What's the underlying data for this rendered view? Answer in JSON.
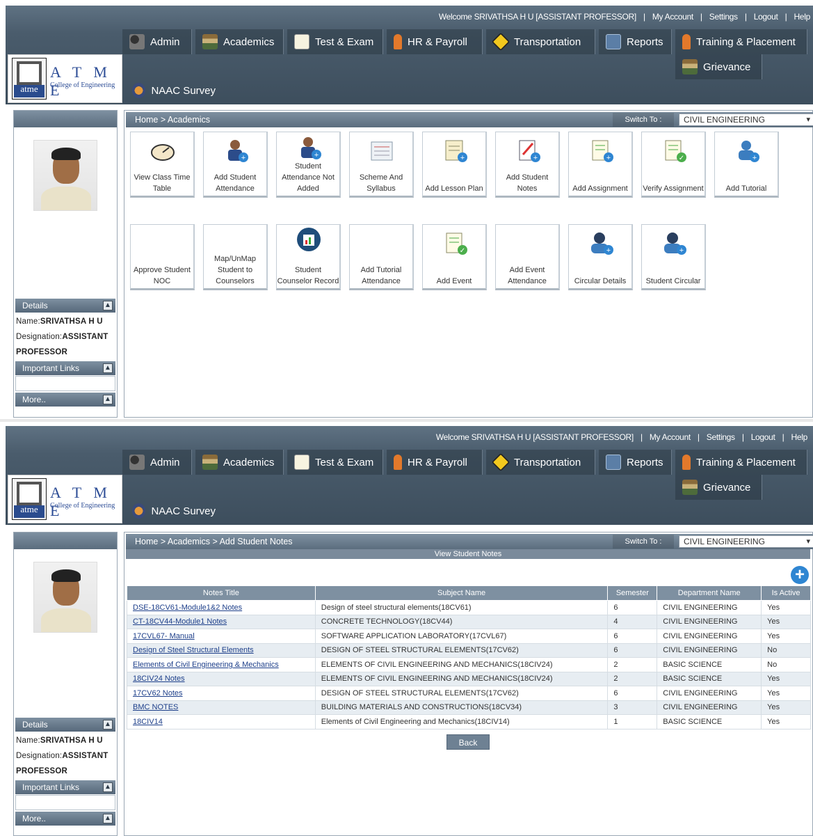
{
  "header": {
    "welcome": "Welcome SRIVATHSA H U [ASSISTANT PROFESSOR]",
    "links": [
      "My Account",
      "Settings",
      "Logout",
      "Help"
    ],
    "logo_text": "A T M E",
    "logo_tag": "atme",
    "logo_subtitle": "College of Engineering",
    "menu": [
      "Admin",
      "Academics",
      "Test & Exam",
      "HR & Payroll",
      "Transportation",
      "Reports",
      "Training & Placement",
      "Grievance",
      "NAAC Survey"
    ]
  },
  "sidebar": {
    "details_label": "Details",
    "name_label": "Name:",
    "name_value": "SRIVATHSA H U",
    "designation_label": "Designation:",
    "designation_value": "ASSISTANT",
    "designation_value2": "PROFESSOR",
    "important_links_label": "Important Links",
    "more_label": "More..",
    "toggle_glyph": "▲"
  },
  "switch": {
    "label": "Switch To :",
    "value": "CIVIL ENGINEERING"
  },
  "pane1": {
    "breadcrumb": "Home > Academics",
    "tiles_row1": [
      "View Class Time Table",
      "Add Student Attendance",
      "Student Attendance Not Added",
      "Scheme And Syllabus",
      "Add Lesson Plan",
      "Add Student Notes",
      "Add Assignment",
      "Verify Assignment",
      "Add Tutorial"
    ],
    "tiles_row2": [
      "Approve Student NOC",
      "Map/UnMap Student to Counselors",
      "Student Counselor Record",
      "Add Tutorial Attendance",
      "Add Event",
      "Add Event Attendance",
      "Circular Details",
      "Student Circular"
    ]
  },
  "pane2": {
    "breadcrumb": "Home > Academics > Add Student Notes",
    "section_title": "View Student Notes",
    "add_glyph": "+",
    "columns": [
      "Notes Title",
      "Subject Name",
      "Semester",
      "Department Name",
      "Is Active"
    ],
    "rows": [
      [
        "DSE-18CV61-Module1&2 Notes",
        "Design of steel structural elements(18CV61)",
        "6",
        "CIVIL ENGINEERING",
        "Yes"
      ],
      [
        "CT-18CV44-Module1 Notes",
        "CONCRETE TECHNOLOGY(18CV44)",
        "4",
        "CIVIL ENGINEERING",
        "Yes"
      ],
      [
        "17CVL67- Manual",
        "SOFTWARE APPLICATION LABORATORY(17CVL67)",
        "6",
        "CIVIL ENGINEERING",
        "Yes"
      ],
      [
        "Design of Steel Structural Elements",
        "DESIGN OF STEEL STRUCTURAL ELEMENTS(17CV62)",
        "6",
        "CIVIL ENGINEERING",
        "No"
      ],
      [
        "Elements of Civil Engineering & Mechanics",
        "ELEMENTS OF CIVIL ENGINEERING AND MECHANICS(18CIV24)",
        "2",
        "BASIC SCIENCE",
        "No"
      ],
      [
        "18CIV24 Notes",
        "ELEMENTS OF CIVIL ENGINEERING AND MECHANICS(18CIV24)",
        "2",
        "BASIC SCIENCE",
        "Yes"
      ],
      [
        "17CV62 Notes",
        "DESIGN OF STEEL STRUCTURAL ELEMENTS(17CV62)",
        "6",
        "CIVIL ENGINEERING",
        "Yes"
      ],
      [
        "BMC NOTES",
        "BUILDING MATERIALS AND CONSTRUCTIONS(18CV34)",
        "3",
        "CIVIL ENGINEERING",
        "Yes"
      ],
      [
        "18CIV14",
        "Elements of Civil Engineering and Mechanics(18CIV14)",
        "1",
        "BASIC SCIENCE",
        "Yes"
      ]
    ],
    "back_label": "Back"
  }
}
